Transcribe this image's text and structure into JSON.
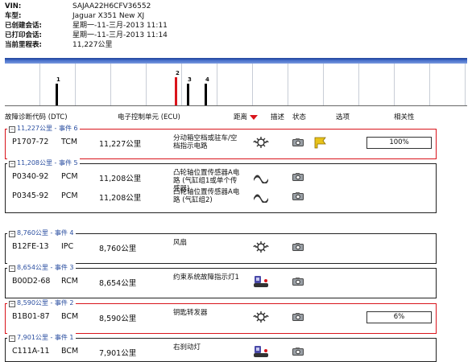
{
  "vehicle": {
    "vin_label": "VIN:",
    "vin": "SAJAA22H6CFV36552",
    "model_label": "车型:",
    "model": "Jaguar X351 New XJ",
    "created_label": "已创建会话:",
    "created": "星期一-11-三月-2013 11:11",
    "printed_label": "已打印会话:",
    "printed": "星期一-11-三月-2013 11:14",
    "mileage_label": "当前里程表:",
    "mileage": "11,227公里"
  },
  "timeline": {
    "events": [
      {
        "label": "1",
        "active": false
      },
      {
        "label": "2",
        "active": true
      },
      {
        "label": "3",
        "active": false
      },
      {
        "label": "4",
        "active": false
      }
    ]
  },
  "columns": {
    "dtc": "故障诊断代码 (DTC)",
    "ecu": "电子控制单元 (ECU)",
    "distance": "距离",
    "description": "描述",
    "status": "状态",
    "options": "选项",
    "relevance": "相关性"
  },
  "groups": [
    {
      "title": "11,227公里 - 事件 6",
      "highlight": true,
      "rows": [
        {
          "code": "P1707-72",
          "ecu": "TCM",
          "distance": "11,227公里",
          "description": "分动箱空档或驻车/空档指示电路",
          "icon": "gear-icon",
          "flag": true,
          "relevance": "100%"
        }
      ]
    },
    {
      "title": "11,208公里 - 事件 5",
      "highlight": false,
      "rows": [
        {
          "code": "P0340-92",
          "ecu": "PCM",
          "distance": "11,208公里",
          "description": "凸轮轴位置传感器A电路 (气缸组1或单个传感器)",
          "icon": "wave-icon",
          "flag": false,
          "relevance": ""
        },
        {
          "code": "P0345-92",
          "ecu": "PCM",
          "distance": "11,208公里",
          "description": "凸轮轴位置传感器A电路 (气缸组2)",
          "icon": "wave-icon",
          "flag": false,
          "relevance": ""
        }
      ]
    },
    {
      "title": "8,760公里 - 事件 4",
      "highlight": false,
      "rows": [
        {
          "code": "B12FE-13",
          "ecu": "IPC",
          "distance": "8,760公里",
          "description": "风扇",
          "icon": "gear-icon",
          "flag": false,
          "relevance": ""
        }
      ]
    },
    {
      "title": "8,654公里 - 事件 3",
      "highlight": false,
      "rows": [
        {
          "code": "B00D2-68",
          "ecu": "RCM",
          "distance": "8,654公里",
          "description": "约束系统故障指示灯1",
          "icon": "seat-icon",
          "flag": false,
          "relevance": ""
        }
      ]
    },
    {
      "title": "8,590公里 - 事件 2",
      "highlight": true,
      "rows": [
        {
          "code": "B1B01-87",
          "ecu": "BCM",
          "distance": "8,590公里",
          "description": "钥匙转发器",
          "icon": "gear-icon",
          "flag": false,
          "relevance": "6%"
        }
      ]
    },
    {
      "title": "7,901公里 - 事件 1",
      "highlight": false,
      "rows": [
        {
          "code": "C111A-11",
          "ecu": "BCM",
          "distance": "7,901公里",
          "description": "右刹动灯",
          "icon": "seat-icon",
          "flag": false,
          "relevance": ""
        }
      ]
    }
  ]
}
